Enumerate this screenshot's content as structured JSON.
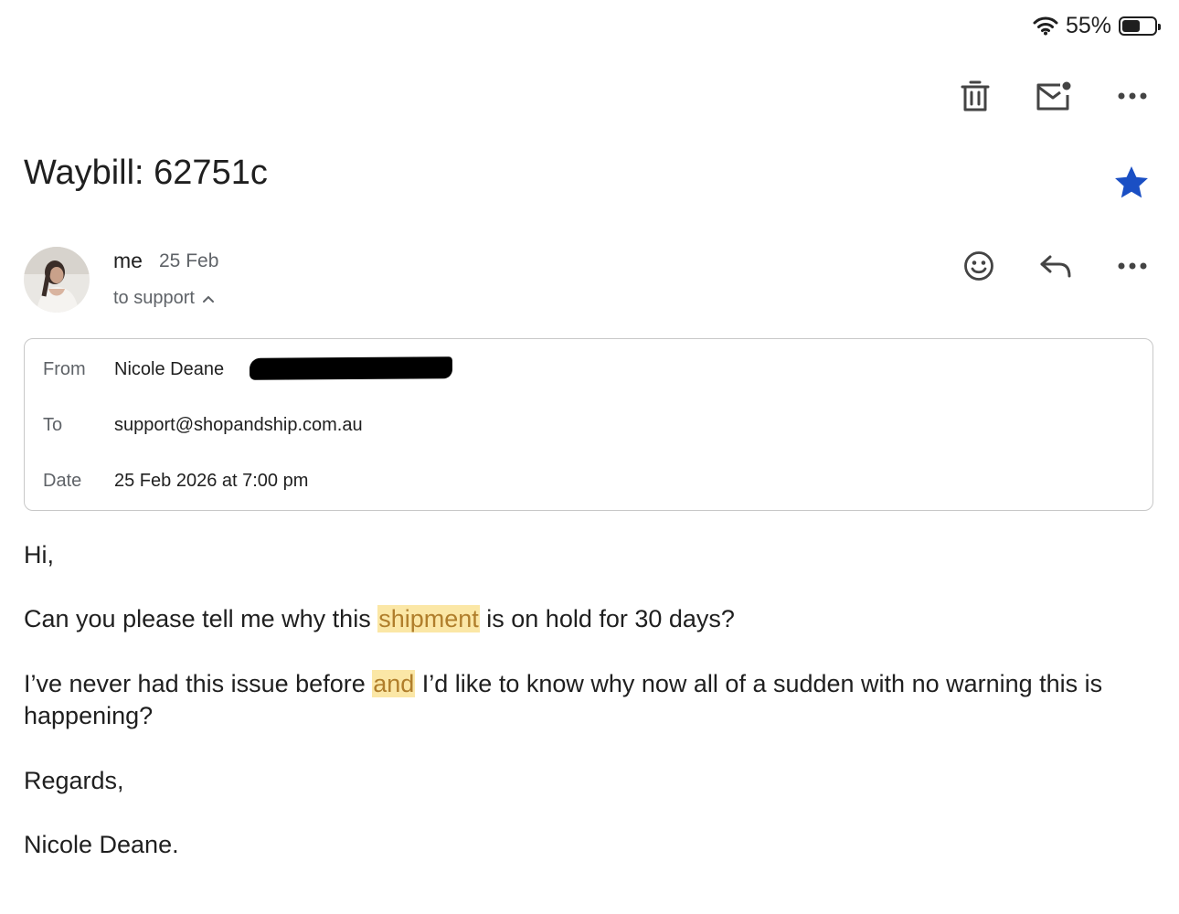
{
  "status_bar": {
    "battery_percent_text": "55%",
    "battery_level": 0.55
  },
  "toolbar": {
    "delete_icon": "trash-icon",
    "mark_unread_icon": "mail-unread-icon",
    "more_icon": "more-horizontal-icon"
  },
  "email": {
    "subject": "Waybill: 62751c",
    "starred": true,
    "star_color": "#1a4fc4",
    "sender": {
      "name": "me",
      "date": "25 Feb",
      "recipients_summary": "to support"
    },
    "details": {
      "from_label": "From",
      "from_name": "Nicole Deane",
      "to_label": "To",
      "to_value": "support@shopandship.com.au",
      "date_label": "Date",
      "date_value": "25 Feb 2026 at 7:00 pm"
    },
    "body": {
      "greeting": "Hi,",
      "p1_before": "Can you please tell me why this ",
      "p1_highlight": "shipment",
      "p1_after": " is on hold for 30 days?",
      "p2_before": "I’ve never had this issue before ",
      "p2_highlight": "and",
      "p2_after": " I’d like to know why now all of a sudden with no warning this is happening?",
      "closing": "Regards,",
      "signature": "Nicole Deane."
    },
    "highlight_color": "#fbe7a6"
  }
}
